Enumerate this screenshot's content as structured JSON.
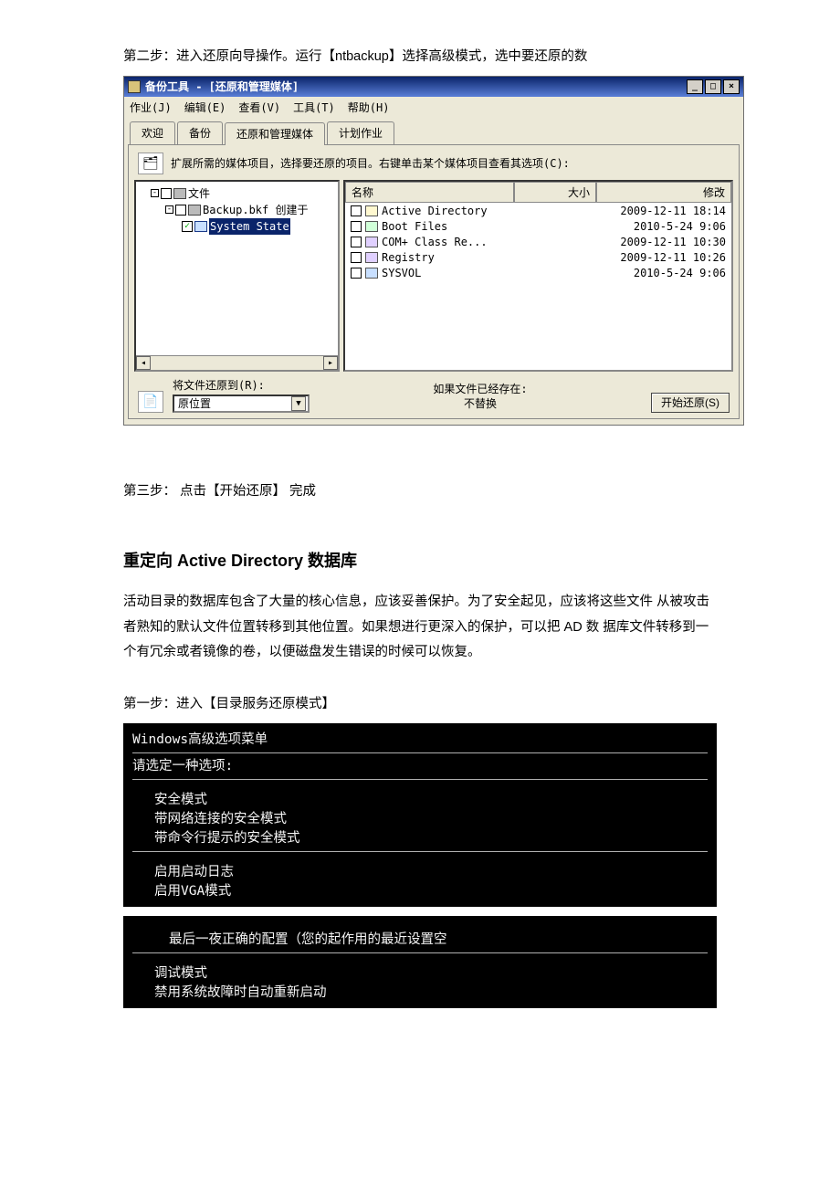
{
  "doc": {
    "step2_intro": "第二步：进入还原向导操作。运行【ntbackup】选择高级模式，选中要还原的数",
    "step3": "第三步： 点击【开始还原】 完成",
    "h2": "重定向 Active Directory 数据库",
    "para1": "活动目录的数据库包含了大量的核心信息，应该妥善保护。为了安全起见，应该将这些文件 从被攻击者熟知的默认文件位置转移到其他位置。如果想进行更深入的保护，可以把 AD 数 据库文件转移到一个有冗余或者镜像的卷，以便磁盘发生错误的时候可以恢复。",
    "step1": "第一步：进入【目录服务还原模式】"
  },
  "tool": {
    "title": "备份工具 - [还原和管理媒体]",
    "menu": {
      "job": "作业(J)",
      "edit": "编辑(E)",
      "view": "查看(V)",
      "tools": "工具(T)",
      "help": "帮助(H)"
    },
    "tabs": {
      "welcome": "欢迎",
      "backup": "备份",
      "restore": "还原和管理媒体",
      "schedule": "计划作业"
    },
    "instruction": "扩展所需的媒体项目，选择要还原的项目。右键单击某个媒体项目查看其选项(C):",
    "tree": {
      "root": "文件",
      "backup_file": "Backup.bkf 创建于",
      "system_state": "System State"
    },
    "columns": {
      "name": "名称",
      "size": "大小",
      "modified": "修改"
    },
    "items": [
      {
        "name": "Active Directory",
        "modified": "2009-12-11 18:14",
        "icon": "ad"
      },
      {
        "name": "Boot Files",
        "modified": "2010-5-24 9:06",
        "icon": "bf"
      },
      {
        "name": "COM+ Class Re...",
        "modified": "2009-12-11 10:30",
        "icon": "com"
      },
      {
        "name": "Registry",
        "modified": "2009-12-11 10:26",
        "icon": "reg"
      },
      {
        "name": "SYSVOL",
        "modified": "2010-5-24 9:06",
        "icon": "sys"
      }
    ],
    "footer": {
      "restore_to_label": "将文件还原到(R):",
      "restore_to_value": "原位置",
      "exists_label": "如果文件已经存在:",
      "exists_value": "不替换",
      "start_button": "开始还原(S)"
    }
  },
  "boot": {
    "heading": "Windows高级选项菜单",
    "prompt": "请选定一种选项:",
    "items_a": [
      "安全模式",
      "带网络连接的安全模式",
      "带命令行提示的安全模式"
    ],
    "items_b": [
      "启用启动日志",
      "启用VGA模式"
    ],
    "block2_line": "最后一夜正确的配置（您的起作用的最近设置空",
    "items_c": [
      "调试模式",
      "禁用系统故障时自动重新启动"
    ]
  }
}
